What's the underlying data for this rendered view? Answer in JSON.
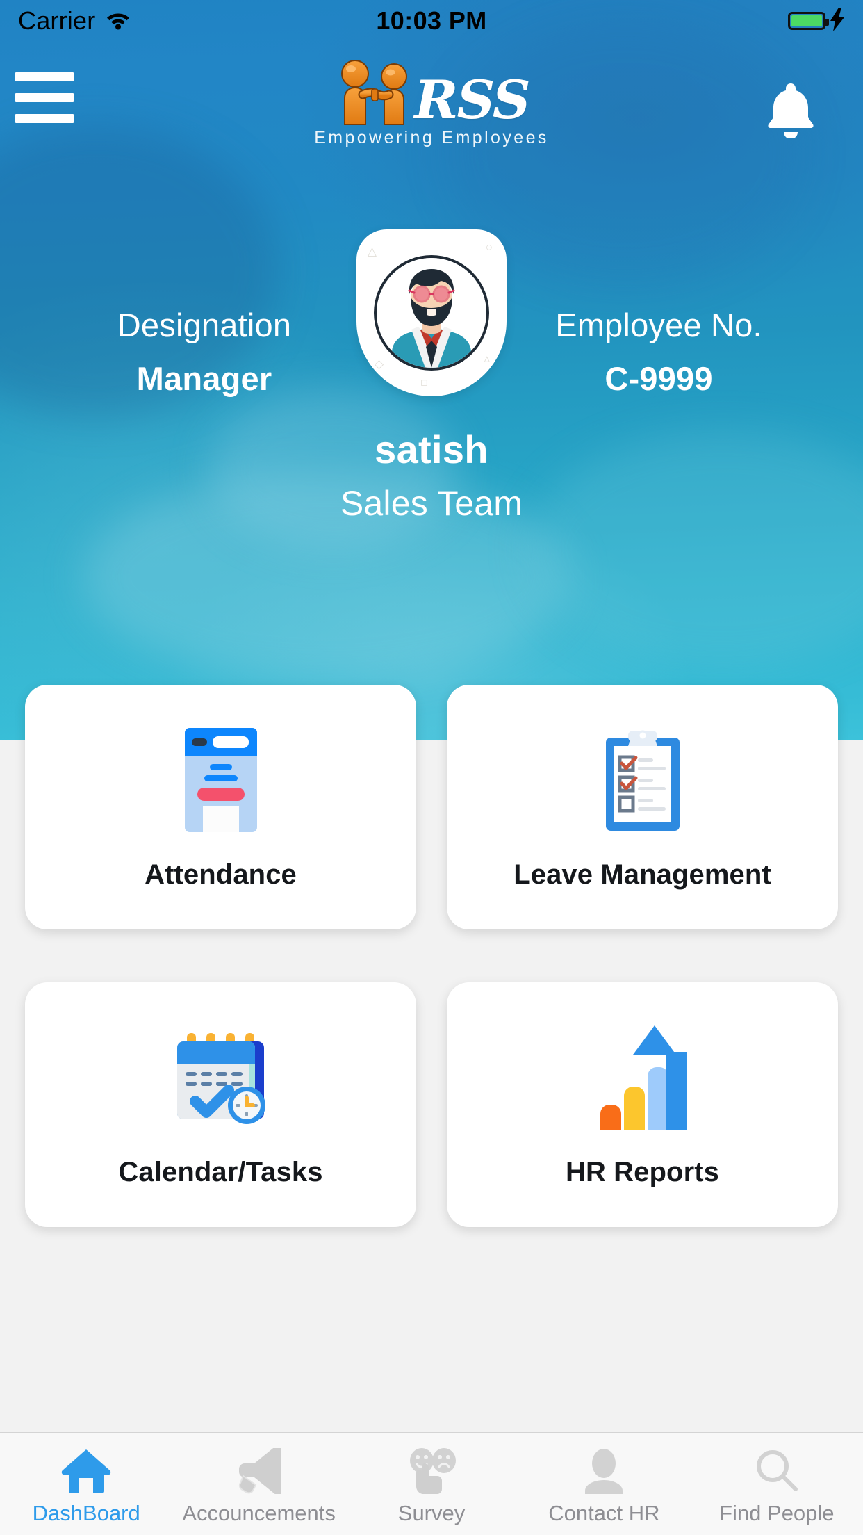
{
  "statusbar": {
    "carrier": "Carrier",
    "wifi_icon": "wifi-icon",
    "time": "10:03 PM",
    "battery_icon": "battery-icon",
    "charging_icon": "lightning-bolt-icon",
    "battery_color": "#4cd964"
  },
  "topbar": {
    "menu_icon": "hamburger-menu-icon",
    "logo_mark_icon": "handshake-logo-icon",
    "logo_text": "RSS",
    "logo_tagline": "Empowering Employees",
    "notification_icon": "bell-icon"
  },
  "profile": {
    "designation_label": "Designation",
    "designation_value": "Manager",
    "employee_no_label": "Employee No.",
    "employee_no_value": "C-9999",
    "avatar_icon": "user-avatar-bearded-man",
    "name": "satish",
    "team": "Sales Team"
  },
  "cards": [
    {
      "icon": "id-card-icon",
      "title": "Attendance"
    },
    {
      "icon": "clipboard-checklist-icon",
      "title": "Leave Management"
    },
    {
      "icon": "calendar-clock-icon",
      "title": "Calendar/Tasks"
    },
    {
      "icon": "bar-chart-arrow-icon",
      "title": "HR Reports"
    }
  ],
  "tabbar": {
    "active_color": "#2e9bea",
    "inactive_color": "#8e8e93",
    "items": [
      {
        "icon": "home-icon",
        "label": "DashBoard",
        "active": true
      },
      {
        "icon": "megaphone-icon",
        "label": "Accouncements",
        "active": false
      },
      {
        "icon": "survey-faces-icon",
        "label": "Survey",
        "active": false
      },
      {
        "icon": "person-icon",
        "label": "Contact HR",
        "active": false
      },
      {
        "icon": "search-icon",
        "label": "Find People",
        "active": false
      }
    ]
  },
  "theme": {
    "hero_top": "#2083c4",
    "hero_bottom": "#3cc2da",
    "card_bg": "#ffffff",
    "accent_blue": "#2e9bea",
    "logo_orange": "#ee8421"
  }
}
